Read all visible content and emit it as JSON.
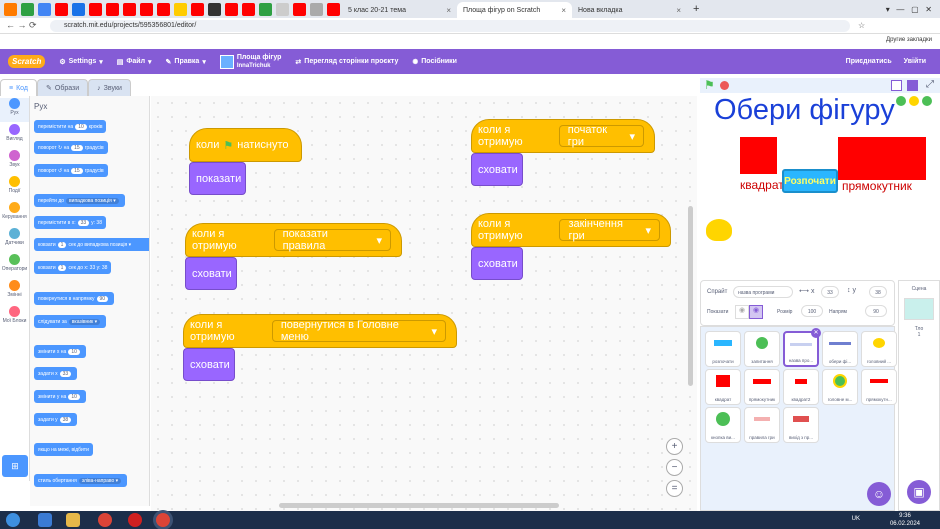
{
  "browser": {
    "tabs": [
      {
        "label": "5 клас 20-21 тема"
      },
      {
        "label": "Площа фігур on Scratch"
      },
      {
        "label": "Нова вкладка"
      }
    ],
    "url": "scratch.mit.edu/projects/595356801/editor/",
    "bookmarks_label": "Другие закладки"
  },
  "menubar": {
    "logo": "Scratch",
    "settings": "Settings",
    "file": "Файл",
    "edit": "Правка",
    "project_title": "Площа фігур",
    "author": "InnaTrichuk",
    "see_project_page": "Перегляд сторінки проєкту",
    "tutorials": "Посібники",
    "share": "Приєднатись",
    "sign_in": "Увійти"
  },
  "editor_tabs": {
    "code": "Код",
    "costumes": "Образи",
    "sounds": "Звуки"
  },
  "categories": [
    {
      "label": "Рух",
      "color": "#4c97ff"
    },
    {
      "label": "Вигляд",
      "color": "#9966ff"
    },
    {
      "label": "Звук",
      "color": "#cf63cf"
    },
    {
      "label": "Події",
      "color": "#ffbf00"
    },
    {
      "label": "Керування",
      "color": "#ffab19"
    },
    {
      "label": "Датчики",
      "color": "#5cb1d6"
    },
    {
      "label": "Оператори",
      "color": "#59c059"
    },
    {
      "label": "Змінні",
      "color": "#ff8c1a"
    },
    {
      "label": "Мої Блоки",
      "color": "#ff6680"
    }
  ],
  "palette": {
    "heading": "Рух",
    "blocks": [
      {
        "text": "перемістити на",
        "value": "10",
        "suffix": "кроків"
      },
      {
        "text": "поворот ↻ на",
        "value": "15",
        "suffix": "градусів"
      },
      {
        "text": "поворот ↺ на",
        "value": "15",
        "suffix": "градусів"
      },
      {
        "text": "перейти до",
        "value": "випадкова позиція ▾",
        "suffix": ""
      },
      {
        "text": "перемістити в x:",
        "value": "33",
        "suffix": "y: 38"
      },
      {
        "text": "ковзати",
        "value": "1",
        "suffix": "сек до випадкова позиція ▾"
      },
      {
        "text": "ковзати",
        "value": "1",
        "suffix": "сек до x: 33 y: 38"
      },
      {
        "text": "повернутися в напрямку",
        "value": "90",
        "suffix": ""
      },
      {
        "text": "слідувати за",
        "value": "вказівник ▾",
        "suffix": ""
      },
      {
        "text": "змінити x на",
        "value": "10",
        "suffix": ""
      },
      {
        "text": "задати x",
        "value": "33",
        "suffix": ""
      },
      {
        "text": "змінити y на",
        "value": "10",
        "suffix": ""
      },
      {
        "text": "задати y",
        "value": "38",
        "suffix": ""
      },
      {
        "text": "якщо на межі, відбити",
        "value": "",
        "suffix": ""
      },
      {
        "text": "стиль обертання",
        "value": "зліва-направо ▾",
        "suffix": ""
      }
    ]
  },
  "scripts": [
    {
      "hat": "коли",
      "hat_suffix": "натиснуто",
      "stack": "показати"
    },
    {
      "hat": "коли я отримую",
      "dropdown": "показати правила",
      "stack": "сховати"
    },
    {
      "hat": "коли я отримую",
      "dropdown": "повернутися в Головне меню",
      "stack": "сховати"
    },
    {
      "hat": "коли я отримую",
      "dropdown": "початок гри",
      "stack": "сховати"
    },
    {
      "hat": "коли я отримую",
      "dropdown": "закінчення гри",
      "stack": "сховати"
    }
  ],
  "stage": {
    "title": "Обери фігуру",
    "label_left": "квадрат",
    "start_button": "Розпочати",
    "label_right": "прямокутник",
    "colors": {
      "red": "#ff0000",
      "title": "#1a40d8",
      "button": "#2ab6ff"
    }
  },
  "sprite_info": {
    "sprite_label": "Спрайт",
    "sprite_name": "назва програми",
    "x": "33",
    "y": "38",
    "show_label": "Показати",
    "size_label": "Розмір",
    "size": "100",
    "direction_label": "Напрям",
    "direction": "90"
  },
  "sprites": [
    "розпочати",
    "запитання",
    "назва про...",
    "обери фі...",
    "головний ...",
    "квадрат",
    "прямокутник",
    "квадрат2",
    "головне м...",
    "прямокутн...",
    "кнопка ви...",
    "правила гри",
    "вихід з пр..."
  ],
  "stage_panel": {
    "label": "Сцена",
    "backdrops_label": "Тло",
    "backdrops_count": "1"
  },
  "taskbar": {
    "lang": "UK",
    "time": "9:36",
    "date": "06.02.2024"
  }
}
